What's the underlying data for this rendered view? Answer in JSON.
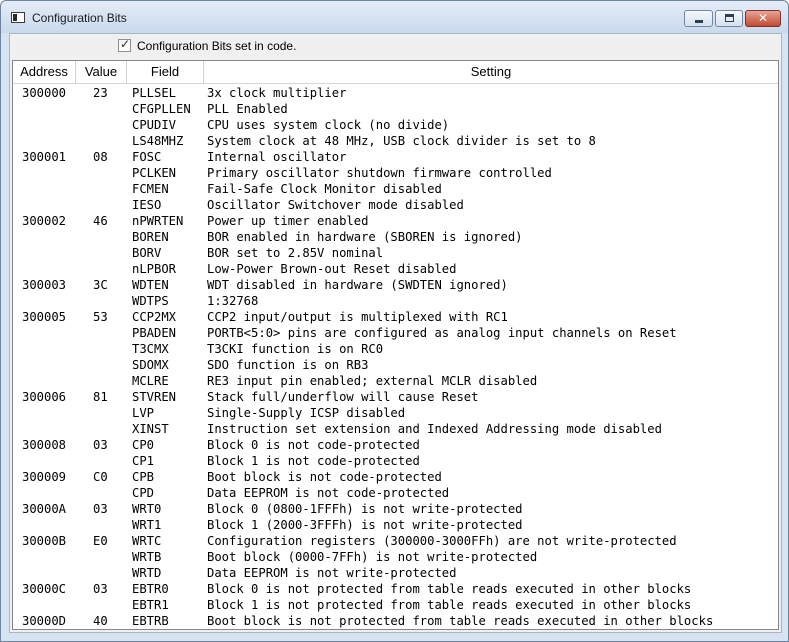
{
  "window": {
    "title": "Configuration Bits",
    "close_glyph": "✕"
  },
  "checkbox": {
    "label": "Configuration Bits set in code.",
    "checked": true,
    "mark": "✓"
  },
  "columns": {
    "address": "Address",
    "value": "Value",
    "field": "Field",
    "setting": "Setting"
  },
  "rows": [
    {
      "address": "300000",
      "value": "23",
      "field": "PLLSEL",
      "setting": "3x clock multiplier"
    },
    {
      "address": "",
      "value": "",
      "field": "CFGPLLEN",
      "setting": "PLL Enabled"
    },
    {
      "address": "",
      "value": "",
      "field": "CPUDIV",
      "setting": "CPU uses system clock (no divide)"
    },
    {
      "address": "",
      "value": "",
      "field": "LS48MHZ",
      "setting": "System clock at 48 MHz, USB clock divider is set to 8"
    },
    {
      "address": "300001",
      "value": "08",
      "field": "FOSC",
      "setting": "Internal oscillator"
    },
    {
      "address": "",
      "value": "",
      "field": "PCLKEN",
      "setting": "Primary oscillator shutdown firmware controlled"
    },
    {
      "address": "",
      "value": "",
      "field": "FCMEN",
      "setting": "Fail-Safe Clock Monitor disabled"
    },
    {
      "address": "",
      "value": "",
      "field": "IESO",
      "setting": "Oscillator Switchover mode disabled"
    },
    {
      "address": "300002",
      "value": "46",
      "field": "nPWRTEN",
      "setting": "Power up timer enabled"
    },
    {
      "address": "",
      "value": "",
      "field": "BOREN",
      "setting": "BOR enabled in hardware (SBOREN is ignored)"
    },
    {
      "address": "",
      "value": "",
      "field": "BORV",
      "setting": "BOR set to 2.85V nominal"
    },
    {
      "address": "",
      "value": "",
      "field": "nLPBOR",
      "setting": "Low-Power Brown-out Reset disabled"
    },
    {
      "address": "300003",
      "value": "3C",
      "field": "WDTEN",
      "setting": "WDT disabled in hardware (SWDTEN ignored)"
    },
    {
      "address": "",
      "value": "",
      "field": "WDTPS",
      "setting": "1:32768"
    },
    {
      "address": "300005",
      "value": "53",
      "field": "CCP2MX",
      "setting": "CCP2 input/output is multiplexed with RC1"
    },
    {
      "address": "",
      "value": "",
      "field": "PBADEN",
      "setting": "PORTB<5:0> pins are configured as analog input channels on Reset"
    },
    {
      "address": "",
      "value": "",
      "field": "T3CMX",
      "setting": "T3CKI function is on RC0"
    },
    {
      "address": "",
      "value": "",
      "field": "SDOMX",
      "setting": "SDO function is on RB3"
    },
    {
      "address": "",
      "value": "",
      "field": "MCLRE",
      "setting": "RE3 input pin enabled; external MCLR disabled"
    },
    {
      "address": "300006",
      "value": "81",
      "field": "STVREN",
      "setting": "Stack full/underflow will cause Reset"
    },
    {
      "address": "",
      "value": "",
      "field": "LVP",
      "setting": "Single-Supply ICSP disabled"
    },
    {
      "address": "",
      "value": "",
      "field": "XINST",
      "setting": "Instruction set extension and Indexed Addressing mode disabled"
    },
    {
      "address": "300008",
      "value": "03",
      "field": "CP0",
      "setting": "Block 0 is not code-protected"
    },
    {
      "address": "",
      "value": "",
      "field": "CP1",
      "setting": "Block 1 is not code-protected"
    },
    {
      "address": "300009",
      "value": "C0",
      "field": "CPB",
      "setting": "Boot block is not code-protected"
    },
    {
      "address": "",
      "value": "",
      "field": "CPD",
      "setting": "Data EEPROM is not code-protected"
    },
    {
      "address": "30000A",
      "value": "03",
      "field": "WRT0",
      "setting": "Block 0 (0800-1FFFh) is not write-protected"
    },
    {
      "address": "",
      "value": "",
      "field": "WRT1",
      "setting": "Block 1 (2000-3FFFh) is not write-protected"
    },
    {
      "address": "30000B",
      "value": "E0",
      "field": "WRTC",
      "setting": "Configuration registers (300000-3000FFh) are not write-protected"
    },
    {
      "address": "",
      "value": "",
      "field": "WRTB",
      "setting": "Boot block (0000-7FFh) is not write-protected"
    },
    {
      "address": "",
      "value": "",
      "field": "WRTD",
      "setting": "Data EEPROM is not write-protected"
    },
    {
      "address": "30000C",
      "value": "03",
      "field": "EBTR0",
      "setting": "Block 0 is not protected from table reads executed in other blocks"
    },
    {
      "address": "",
      "value": "",
      "field": "EBTR1",
      "setting": "Block 1 is not protected from table reads executed in other blocks"
    },
    {
      "address": "30000D",
      "value": "40",
      "field": "EBTRB",
      "setting": "Boot block is not protected from table reads executed in other blocks"
    }
  ]
}
